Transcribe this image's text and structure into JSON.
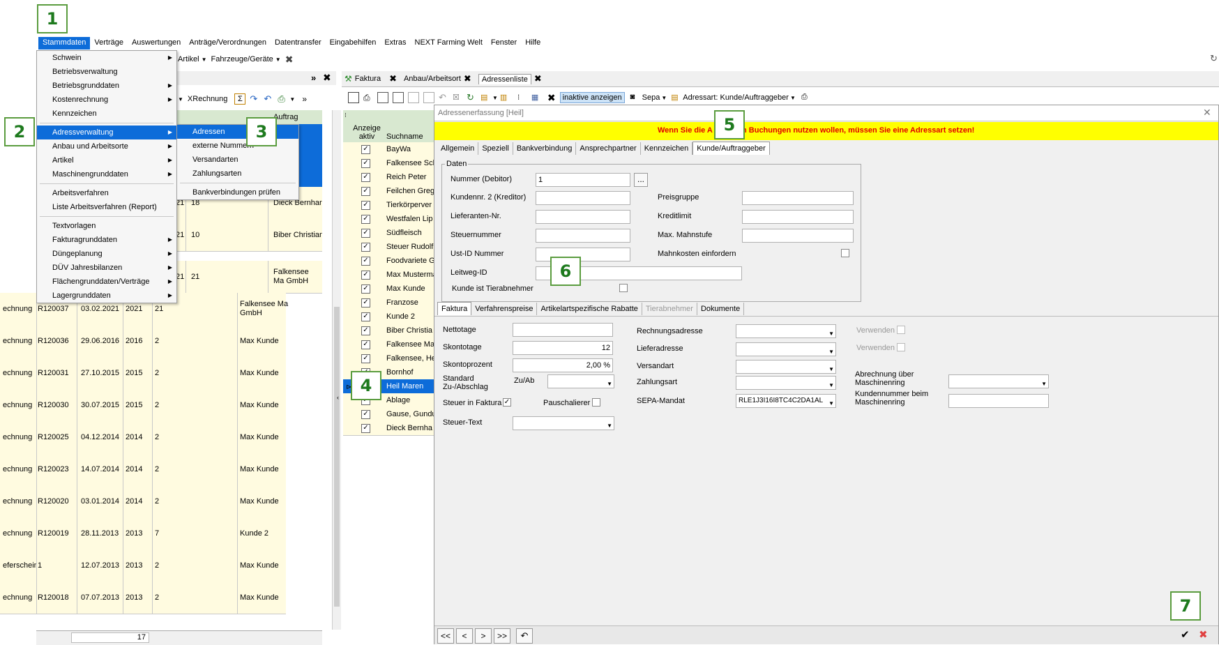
{
  "menubar": [
    "Stammdaten",
    "Verträge",
    "Auswertungen",
    "Anträge/Verordnungen",
    "Datentransfer",
    "Eingabehilfen",
    "Extras",
    "NEXT Farming Welt",
    "Fenster",
    "Hilfe"
  ],
  "toolbar2": {
    "artikel": "Artikel",
    "fahrzeuge": "Fahrzeuge/Geräte"
  },
  "left_toolbar": {
    "xrechnung": "XRechnung"
  },
  "stammdaten_menu": [
    "Schwein",
    "Betriebsverwaltung",
    "Betriebsgrunddaten",
    "Kostenrechnung",
    "Kennzeichen",
    "Adressverwaltung",
    "Anbau und Arbeitsorte",
    "Artikel",
    "Maschinengrunddaten",
    "Arbeitsverfahren",
    "Liste Arbeitsverfahren (Report)",
    "Textvorlagen",
    "Fakturagrunddaten",
    "Düngeplanung",
    "DÜV Jahresbilanzen",
    "Flächengrunddaten/Verträge",
    "Lagergrunddaten"
  ],
  "adress_submenu": [
    "Adressen",
    "externe Nummern",
    "Versandarten",
    "Zahlungsarten",
    "Bankverbindungen prüfen"
  ],
  "left_header": {
    "col": "Auftrag"
  },
  "left_partial": [
    {
      "c4": "hristian"
    },
    {
      "a": "21",
      "b": "18",
      "c": "Dieck Bernhar"
    },
    {
      "a": "21",
      "b": "10",
      "c": "Biber Christian"
    },
    {
      "a": "21",
      "b": "21",
      "c": "Falkensee Ma GmbH"
    }
  ],
  "left_rows": [
    {
      "typ": "echnung",
      "nr": "R120037",
      "datum": "03.02.2021",
      "jahr": "2021",
      "n": "21",
      "kunde": "Falkensee Ma GmbH"
    },
    {
      "typ": "echnung",
      "nr": "R120036",
      "datum": "29.06.2016",
      "jahr": "2016",
      "n": "2",
      "kunde": "Max Kunde"
    },
    {
      "typ": "echnung",
      "nr": "R120031",
      "datum": "27.10.2015",
      "jahr": "2015",
      "n": "2",
      "kunde": "Max Kunde"
    },
    {
      "typ": "echnung",
      "nr": "R120030",
      "datum": "30.07.2015",
      "jahr": "2015",
      "n": "2",
      "kunde": "Max Kunde"
    },
    {
      "typ": "echnung",
      "nr": "R120025",
      "datum": "04.12.2014",
      "jahr": "2014",
      "n": "2",
      "kunde": "Max Kunde"
    },
    {
      "typ": "echnung",
      "nr": "R120023",
      "datum": "14.07.2014",
      "jahr": "2014",
      "n": "2",
      "kunde": "Max Kunde"
    },
    {
      "typ": "echnung",
      "nr": "R120020",
      "datum": "03.01.2014",
      "jahr": "2014",
      "n": "2",
      "kunde": "Max Kunde"
    },
    {
      "typ": "echnung",
      "nr": "R120019",
      "datum": "28.11.2013",
      "jahr": "2013",
      "n": "7",
      "kunde": "Kunde 2"
    },
    {
      "typ": "eferschein",
      "nr": "1",
      "datum": "12.07.2013",
      "jahr": "2013",
      "n": "2",
      "kunde": "Max Kunde"
    },
    {
      "typ": "echnung",
      "nr": "R120018",
      "datum": "07.07.2013",
      "jahr": "2013",
      "n": "2",
      "kunde": "Max Kunde"
    }
  ],
  "left_footer": {
    "count": "17"
  },
  "tabs": [
    "Faktura",
    "Anbau/Arbeitsort",
    "Adressenliste"
  ],
  "list_toolbar": {
    "inaktive": "inaktive anzeigen",
    "sepa": "Sepa",
    "adressart": "Adressart: Kunde/Auftraggeber"
  },
  "list_header": {
    "aktiv": "Anzeige aktiv",
    "suchname": "Suchname"
  },
  "list_names": [
    "BayWa",
    "Falkensee Sch",
    "Reich Peter",
    "Feilchen Greg",
    "Tierkörperver",
    "Westfalen Lip",
    "Südfleisch",
    "Steuer Rudolf",
    "Foodvariete G",
    "Max Musterma",
    "Max Kunde",
    "Franzose",
    "Kunde 2",
    "Biber Christia",
    "Falkensee Ma",
    "Falkensee, He",
    "Bornhof",
    "Heil Maren",
    "Ablage",
    "Gause, Gundu",
    "Dieck Bernha"
  ],
  "dialog": {
    "title": "Adressenerfassung  [Heil]",
    "warning": "Wenn Sie die Adresse in Buchungen nutzen wollen, müssen Sie eine Adressart setzen!",
    "warning_visible_left": "Wenn Sie die A",
    "warning_visible_right": "n Buchungen nutzen wollen, müssen Sie eine Adressart setzen!",
    "tabs": [
      "Allgemein",
      "Speziell",
      "Bankverbindung",
      "Ansprechpartner",
      "Kennzeichen",
      "Kunde/Auftraggeber"
    ],
    "group": "Daten",
    "labels": {
      "nummer": "Nummer (Debitor)",
      "kundennr2": "Kundennr. 2 (Kreditor)",
      "lieferanten": "Lieferanten-Nr.",
      "steuernummer": "Steuernummer",
      "ustid": "Ust-ID Nummer",
      "leitweg": "Leitweg-ID",
      "tierabnehmer": "Kunde ist Tierabnehmer",
      "preisgruppe": "Preisgruppe",
      "kreditlimit": "Kreditlimit",
      "mahnstufe": "Max. Mahnstufe",
      "mahnkosten": "Mahnkosten einfordern"
    },
    "values": {
      "nummer": "1",
      "dots": "..."
    },
    "subtabs": [
      "Faktura",
      "Verfahrenspreise",
      "Artikelartspezifische Rabatte",
      "Tierabnehmer",
      "Dokumente"
    ],
    "faktura": {
      "nettotage": "Nettotage",
      "skontotage": "Skontotage",
      "skontotage_val": "12",
      "skontoprozent": "Skontoprozent",
      "skontoprozent_val": "2,00 %",
      "standard": "Standard Zu-/Abschlag",
      "zuab": "Zu/Ab",
      "steuer_faktura": "Steuer in Faktura",
      "pauschalierer": "Pauschalierer",
      "steuer_text": "Steuer-Text",
      "rechnungsadresse": "Rechnungsadresse",
      "lieferadresse": "Lieferadresse",
      "versandart": "Versandart",
      "zahlungsart": "Zahlungsart",
      "sepa": "SEPA-Mandat",
      "sepa_val": "RLE1J3I16I8TC4C2DA1AL",
      "verwenden": "Verwenden",
      "abrechnung": "Abrechnung über Maschinenring",
      "kundennummer_mr": "Kundennummer beim Maschinenring"
    },
    "nav": [
      "<<",
      "<",
      ">",
      ">>"
    ]
  },
  "callouts": [
    "1",
    "2",
    "3",
    "4",
    "5",
    "6",
    "7"
  ],
  "colors": {
    "accent": "#0d6cd9",
    "warning_bg": "#ffff00",
    "warning_text": "#e00000",
    "green": "#1e7a1e",
    "row_bg": "#fffbe0"
  }
}
